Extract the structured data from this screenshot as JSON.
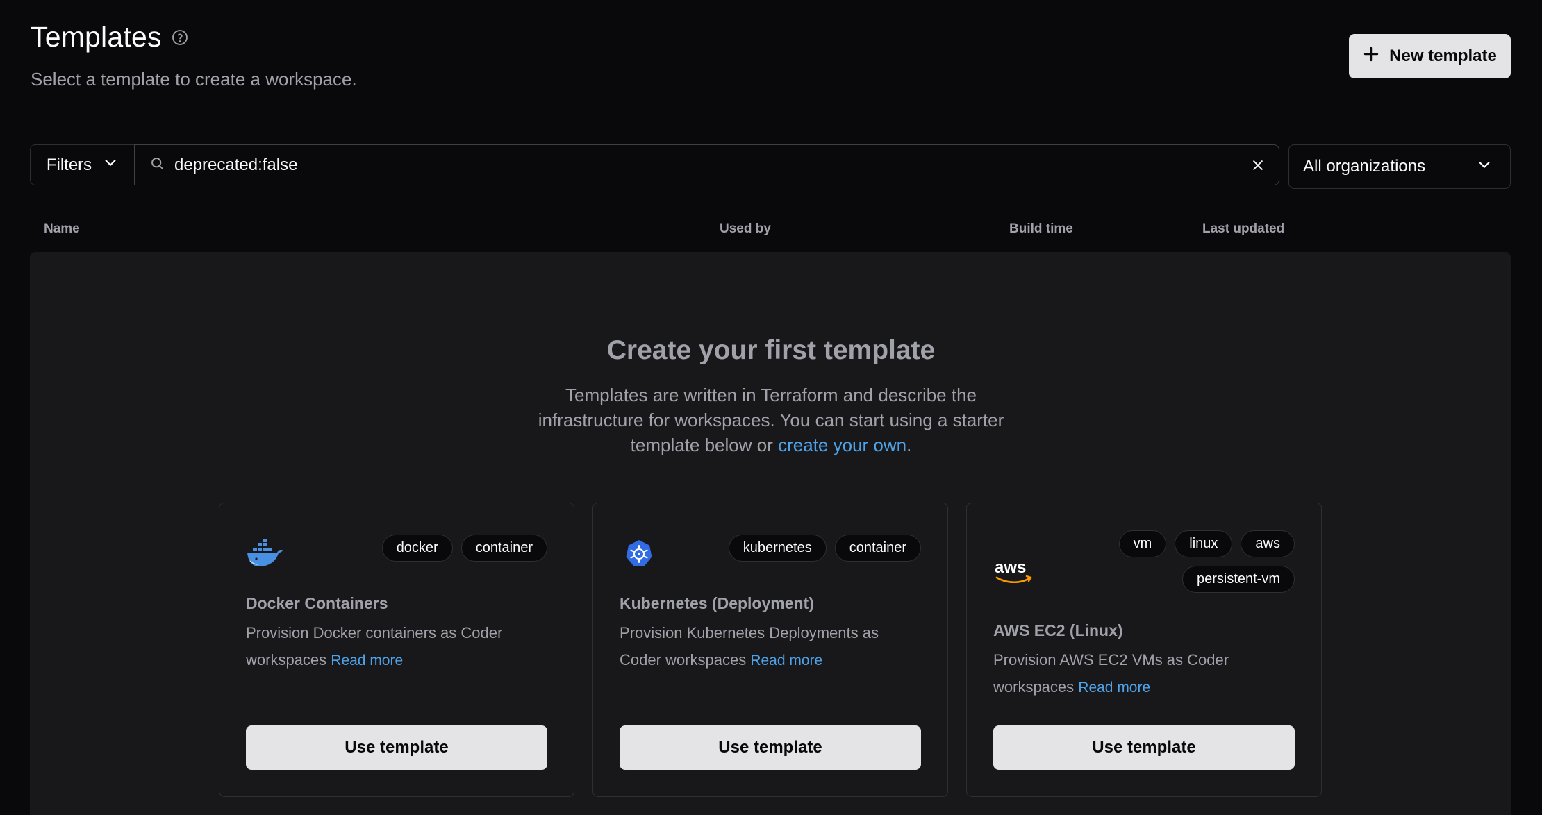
{
  "header": {
    "title": "Templates",
    "subtitle": "Select a template to create a workspace.",
    "help_icon": "help-circle-icon",
    "new_button_label": "New template"
  },
  "filters": {
    "filters_label": "Filters",
    "search_value": "deprecated:false",
    "organization_selected": "All organizations"
  },
  "table": {
    "columns": [
      "Name",
      "Used by",
      "Build time",
      "Last updated"
    ]
  },
  "empty_state": {
    "title": "Create your first template",
    "description_prefix": "Templates are written in Terraform and describe the infrastructure for workspaces. You can start using a starter template below or ",
    "description_link": "create your own",
    "description_suffix": "."
  },
  "starters": [
    {
      "icon": "docker-icon",
      "tags": [
        "docker",
        "container"
      ],
      "name": "Docker Containers",
      "description": "Provision Docker containers as Coder workspaces",
      "read_more": "Read more",
      "button": "Use template"
    },
    {
      "icon": "kubernetes-icon",
      "tags": [
        "kubernetes",
        "container"
      ],
      "name": "Kubernetes (Deployment)",
      "description": "Provision Kubernetes Deployments as Coder workspaces",
      "read_more": "Read more",
      "button": "Use template"
    },
    {
      "icon": "aws-icon",
      "tags": [
        "vm",
        "linux",
        "aws",
        "persistent-vm"
      ],
      "name": "AWS EC2 (Linux)",
      "description": "Provision AWS EC2 VMs as Coder workspaces",
      "read_more": "Read more",
      "button": "Use template"
    }
  ],
  "colors": {
    "background": "#09090b",
    "surface": "#18181b",
    "link": "#4ea2e8",
    "button_bg": "#e4e4e7"
  }
}
